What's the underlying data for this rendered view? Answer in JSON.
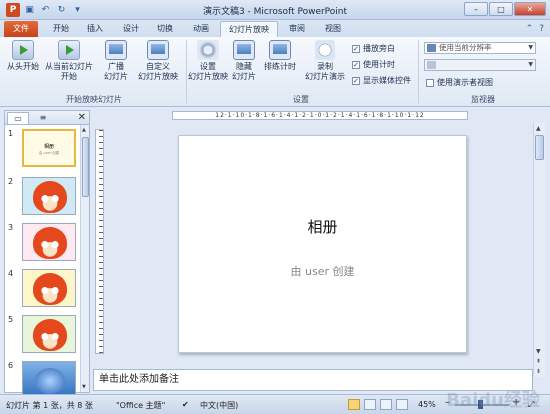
{
  "title_bar": {
    "title": "演示文稿3 - Microsoft PowerPoint",
    "logo_letter": "P",
    "min": "–",
    "max": "□",
    "close": "✕"
  },
  "tabs": [
    {
      "label": "文件"
    },
    {
      "label": "开始"
    },
    {
      "label": "插入"
    },
    {
      "label": "设计"
    },
    {
      "label": "切换"
    },
    {
      "label": "动画"
    },
    {
      "label": "幻灯片放映"
    },
    {
      "label": "审阅"
    },
    {
      "label": "视图"
    }
  ],
  "active_tab": "幻灯片放映",
  "ribbon": {
    "start_group": {
      "label": "开始放映幻灯片",
      "from_beginning": "从头开始",
      "from_current_l1": "从当前幻灯片",
      "from_current_l2": "开始",
      "broadcast_l1": "广播",
      "broadcast_l2": "幻灯片",
      "custom_l1": "自定义",
      "custom_l2": "幻灯片放映"
    },
    "setup_group": {
      "label": "设置",
      "setup_l1": "设置",
      "setup_l2": "幻灯片放映",
      "hide_l1": "隐藏",
      "hide_l2": "幻灯片",
      "rehearse": "排练计时",
      "record_l1": "录制",
      "record_l2": "幻灯片演示",
      "play_narration": "播放旁白",
      "use_timings": "使用计时",
      "show_media": "显示媒体控件",
      "check_mark": "✓"
    },
    "monitor_group": {
      "label": "监视器",
      "resolution": "使用当前分辨率",
      "presenter_view": "使用演示者视图"
    }
  },
  "panel": {
    "tab_slides": "",
    "tab_outline": "",
    "close": "✕",
    "thumbnails": [
      {
        "num": "1",
        "title": "相册",
        "sub": "由 user 创建"
      },
      {
        "num": "2"
      },
      {
        "num": "3"
      },
      {
        "num": "4"
      },
      {
        "num": "5"
      },
      {
        "num": "6"
      }
    ]
  },
  "ruler_text": "12·1·10·1·8·1·6·1·4·1·2·1·0·1·2·1·4·1·6·1·8·1·10·1·12",
  "slide": {
    "title": "相册",
    "subtitle": "由 user 创建"
  },
  "notes_placeholder": "单击此处添加备注",
  "status_bar": {
    "slide_info": "幻灯片 第 1 张，共 8 张",
    "theme": "\"Office 主题\"",
    "language": "中文(中国)",
    "zoom": "45%",
    "zoom_minus": "–",
    "zoom_plus": "+"
  },
  "watermark": "Baidu经验"
}
